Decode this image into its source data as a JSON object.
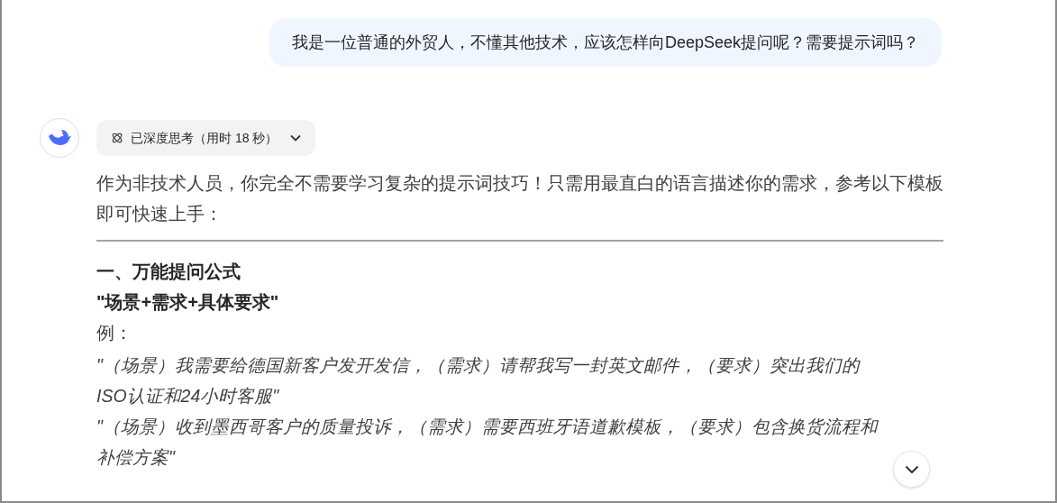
{
  "user_message": {
    "text": "我是一位普通的外贸人，不懂其他技术，应该怎样向DeepSeek提问呢？需要提示词吗？"
  },
  "assistant": {
    "thinking": {
      "label": "已深度思考（用时 18 秒）",
      "expanded": false
    },
    "blocks": [
      {
        "kind": "paragraph",
        "text": "作为非技术人员，你完全不需要学习复杂的提示词技巧！只需用最直白的语言描述你的需求，参考以下模板即可快速上手："
      },
      {
        "kind": "rule"
      },
      {
        "kind": "heading",
        "text": "一、万能提问公式"
      },
      {
        "kind": "heading",
        "text": "\"场景+需求+具体要求\""
      },
      {
        "kind": "paragraph",
        "text": "例："
      },
      {
        "kind": "example",
        "text": "\"（场景）我需要给德国新客户发开发信，（需求）请帮我写一封英文邮件，（要求）突出我们的ISO认证和24小时客服\""
      },
      {
        "kind": "example",
        "text": "\"（场景）收到墨西哥客户的质量投诉，（需求）需要西班牙语道歉模板，（要求）包含换货流程和补偿方案\""
      }
    ]
  }
}
